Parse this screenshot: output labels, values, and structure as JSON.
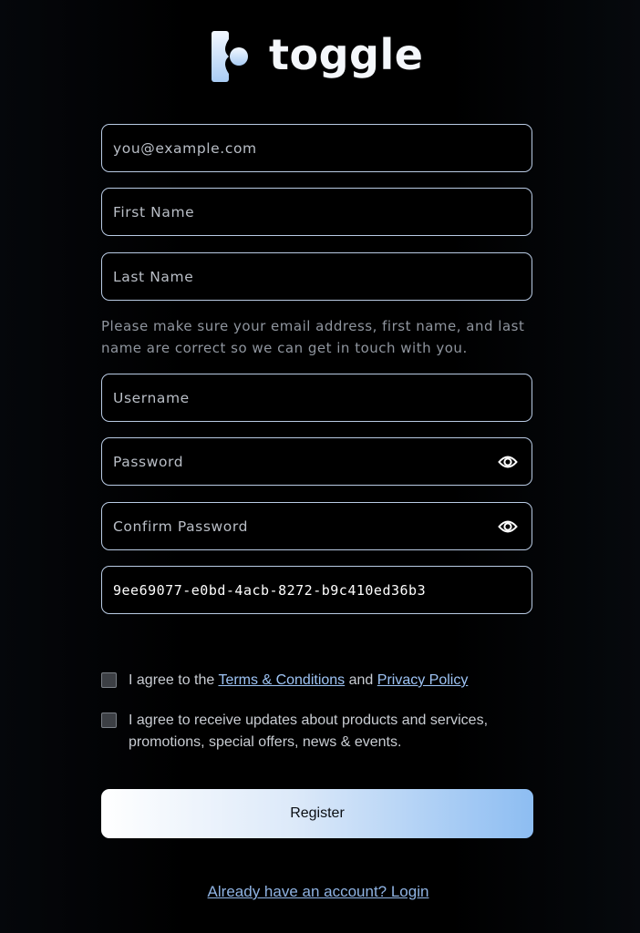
{
  "brand": {
    "logo_icon": "toggle-logo-icon",
    "name": "toggle",
    "accent_color": "#8dbdf2"
  },
  "form": {
    "email": {
      "placeholder": "you@example.com",
      "value": ""
    },
    "first_name": {
      "placeholder": "First Name",
      "value": ""
    },
    "last_name": {
      "placeholder": "Last Name",
      "value": ""
    },
    "helper_text": "Please make sure your email address, first name, and last name are correct so we can get in touch with you.",
    "username": {
      "placeholder": "Username",
      "value": ""
    },
    "password": {
      "placeholder": "Password",
      "value": "",
      "toggle_icon": "eye-icon"
    },
    "confirm_password": {
      "placeholder": "Confirm Password",
      "value": "",
      "toggle_icon": "eye-icon"
    },
    "token": {
      "value": "9ee69077-e0bd-4acb-8272-b9c410ed36b3"
    }
  },
  "agreements": {
    "terms": {
      "checked": false,
      "prefix": "I agree to the ",
      "terms_link": "Terms & Conditions",
      "middle": " and ",
      "privacy_link": "Privacy Policy"
    },
    "updates": {
      "checked": false,
      "label": "I agree to receive updates about products and services, promotions, special offers, news & events."
    }
  },
  "actions": {
    "register_label": "Register",
    "login_link": "Already have an account? Login"
  }
}
